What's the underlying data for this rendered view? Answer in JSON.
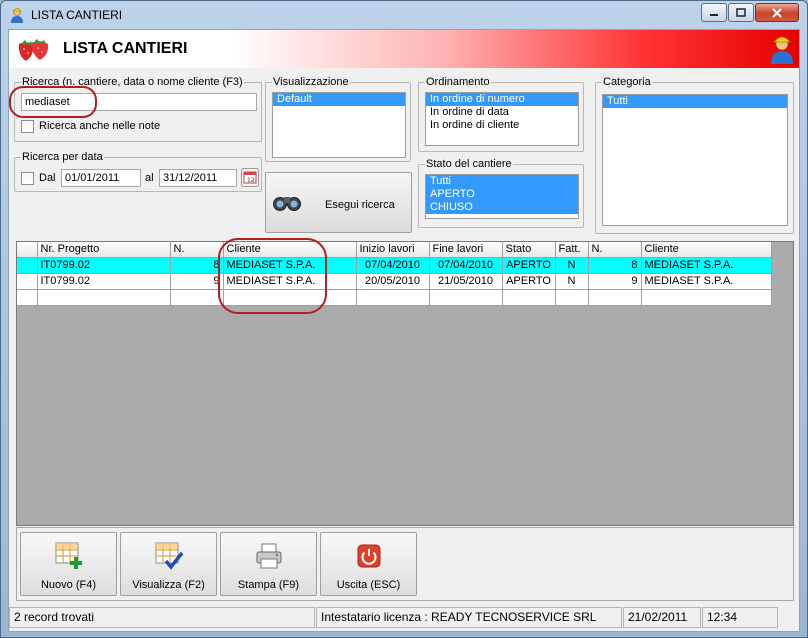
{
  "window": {
    "title": "LISTA CANTIERI",
    "header_title": "LISTA CANTIERI"
  },
  "search": {
    "label": "Ricerca (n. cantiere, data o nome cliente (F3)",
    "value": "mediaset",
    "notes_checkbox_label": "Ricerca anche nelle note"
  },
  "date_search": {
    "label": "Ricerca per data",
    "from_label": "Dal",
    "from_value": "01/01/2011",
    "to_label": "al",
    "to_value": "31/12/2011"
  },
  "visualizzazione": {
    "label": "Visualizzazione",
    "items": [
      "Default"
    ]
  },
  "ordinamento": {
    "label": "Ordinamento",
    "items": [
      "In ordine di numero",
      "In ordine di data",
      "In ordine di cliente"
    ]
  },
  "stato": {
    "label": "Stato del cantiere",
    "items": [
      "Tutti",
      "APERTO",
      "CHIUSO"
    ]
  },
  "categoria": {
    "label": "Categoria",
    "items": [
      "Tutti"
    ]
  },
  "search_button": {
    "label": "Esegui ricerca"
  },
  "grid": {
    "columns": [
      "Nr. Progetto",
      "N.",
      "Cliente",
      "Inizio lavori",
      "Fine lavori",
      "Stato",
      "Fatt.",
      "N.",
      "Cliente"
    ],
    "rows": [
      [
        "IT0799.02",
        "8",
        "MEDIASET S.P.A.",
        "07/04/2010",
        "07/04/2010",
        "APERTO",
        "N",
        "8",
        "MEDIASET S.P.A."
      ],
      [
        "IT0799.02",
        "9",
        "MEDIASET S.P.A.",
        "20/05/2010",
        "21/05/2010",
        "APERTO",
        "N",
        "9",
        "MEDIASET S.P.A."
      ]
    ]
  },
  "buttons": {
    "new": "Nuovo (F4)",
    "view": "Visualizza (F2)",
    "print": "Stampa (F9)",
    "exit": "Uscita (ESC)"
  },
  "status": {
    "records": "2 record trovati",
    "license": "Intestatario licenza : READY TECNOSERVICE SRL",
    "date": "21/02/2011",
    "time": "12:34"
  },
  "colors": {
    "selection": "#3399ff",
    "highlight_row": "#00ffff",
    "annotation_ring": "#b02020"
  }
}
